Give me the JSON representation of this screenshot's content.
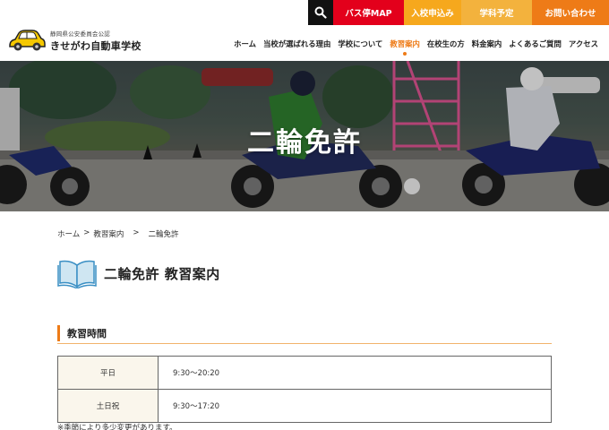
{
  "topbar": {
    "search_icon": "search-icon",
    "bus_label": "バス停MAP",
    "enroll_label": "入校申込み",
    "schedule_label": "学科予定",
    "contact_label": "お問い合わせ",
    "colors": {
      "bus": "#e3001b",
      "enroll": "#f6a81d",
      "schedule": "#f3b23d",
      "contact": "#ee7b17"
    }
  },
  "logo": {
    "icon": "car-icon",
    "subtitle": "静岡県公安委員会公認",
    "name": "きせがわ自動車学校"
  },
  "nav": {
    "items": [
      {
        "label": "ホーム"
      },
      {
        "label": "当校が選ばれる理由"
      },
      {
        "label": "学校について"
      },
      {
        "label": "教習案内",
        "active": true
      },
      {
        "label": "在校生の方"
      },
      {
        "label": "料金案内"
      },
      {
        "label": "よくあるご質問"
      },
      {
        "label": "アクセス"
      }
    ]
  },
  "hero": {
    "title": "二輪免許"
  },
  "breadcrumb": {
    "home": "ホーム",
    "sep1": ">",
    "parent": "教習案内",
    "sep2": ">",
    "current": "二輪免許"
  },
  "page": {
    "icon": "open-book-icon",
    "title": "二輪免許 教習案内"
  },
  "section": {
    "title": "教習時間",
    "accent": "#ee7b17"
  },
  "hours": {
    "rows": [
      {
        "label": "平日",
        "value": "9:30〜20:20"
      },
      {
        "label": "土日祝",
        "value": "9:30〜17:20"
      }
    ],
    "note": "※季節により多少変更があります。"
  }
}
